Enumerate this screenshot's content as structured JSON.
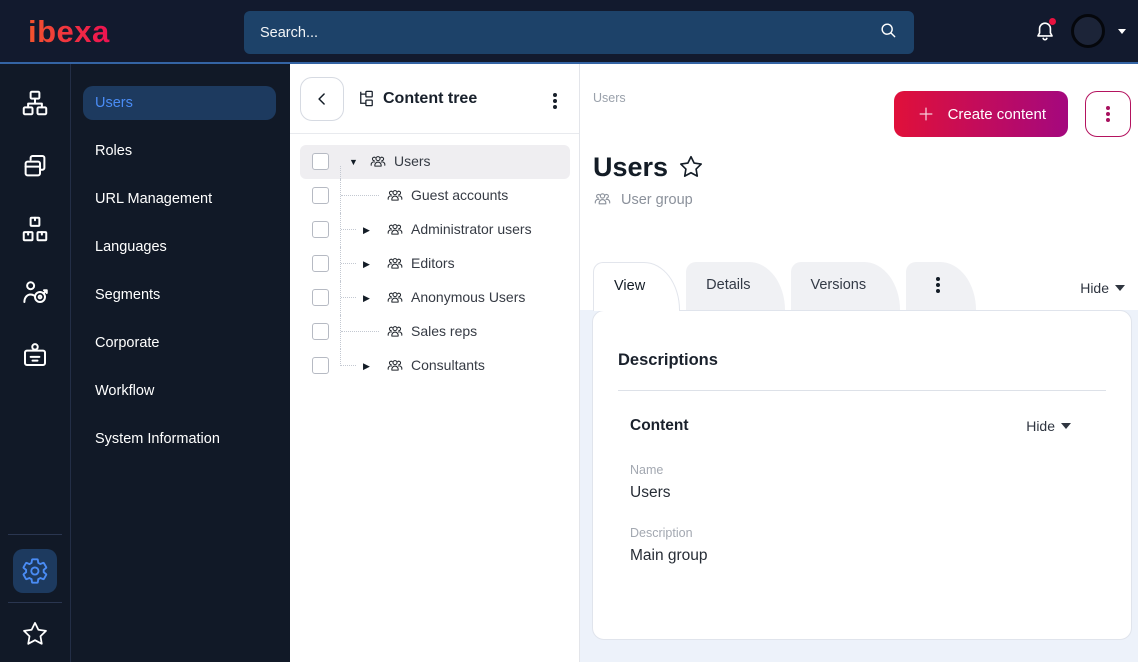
{
  "topbar": {
    "logo": "ibexa",
    "search_placeholder": "Search..."
  },
  "icons": [
    "search-icon",
    "bell-icon",
    "caret-down-icon",
    "content-structure-icon",
    "pages-icon",
    "products-icon",
    "customers-icon",
    "badge-icon",
    "gear-icon",
    "star-icon",
    "back-chevron-icon",
    "content-tree-icon",
    "kebab-menu-icon",
    "user-group-icon",
    "plus-icon",
    "favorite-star-icon"
  ],
  "sidebar": {
    "items": [
      {
        "label": "Users",
        "active": true
      },
      {
        "label": "Roles"
      },
      {
        "label": "URL Management"
      },
      {
        "label": "Languages"
      },
      {
        "label": "Segments"
      },
      {
        "label": "Corporate"
      },
      {
        "label": "Workflow"
      },
      {
        "label": "System Information"
      }
    ]
  },
  "content_tree": {
    "title": "Content tree",
    "rows": [
      {
        "label": "Users",
        "caret": "▼",
        "selected": true
      },
      {
        "label": "Guest accounts",
        "caret": "",
        "child": true
      },
      {
        "label": "Administrator users",
        "caret": "▶",
        "child": true
      },
      {
        "label": "Editors",
        "caret": "▶",
        "child": true
      },
      {
        "label": "Anonymous Users",
        "caret": "▶",
        "child": true
      },
      {
        "label": "Sales reps",
        "caret": "",
        "child": true
      },
      {
        "label": "Consultants",
        "caret": "▶",
        "child": true,
        "last": true
      }
    ]
  },
  "main": {
    "breadcrumb": "Users",
    "create_button_label": "Create content",
    "title": "Users",
    "content_type": "User group",
    "tabs": [
      {
        "label": "View",
        "active": true
      },
      {
        "label": "Details"
      },
      {
        "label": "Versions"
      },
      {
        "label": "",
        "kebab": true
      }
    ],
    "hide_toggle_label": "Hide",
    "descriptions_title": "Descriptions",
    "content_section": {
      "title": "Content",
      "hide_toggle_label": "Hide",
      "fields": [
        {
          "label": "Name",
          "value": "Users"
        },
        {
          "label": "Description",
          "value": "Main group"
        }
      ]
    }
  },
  "colors": {
    "topbar_bg": "#121a2e",
    "topbar_accent_line": "#3464a4",
    "search_bg": "#1d4269",
    "sidebar_bg": "#111927",
    "selected_item_bg": "#1d3a5f",
    "selected_item_text": "#4a8cf5",
    "logo_gradient": [
      "#f2542d",
      "#ee1152"
    ],
    "create_button_gradient": [
      "#e0103a",
      "#a4087e"
    ],
    "kebab_button_accent": "#b4135f",
    "notification_dot": "#e8123f",
    "tree_selected_row_bg": "#efeef1",
    "content_bg": "#edf2fa",
    "card_border": "#e0e4ec",
    "tab_inactive_bg": "#f0f1f4"
  }
}
